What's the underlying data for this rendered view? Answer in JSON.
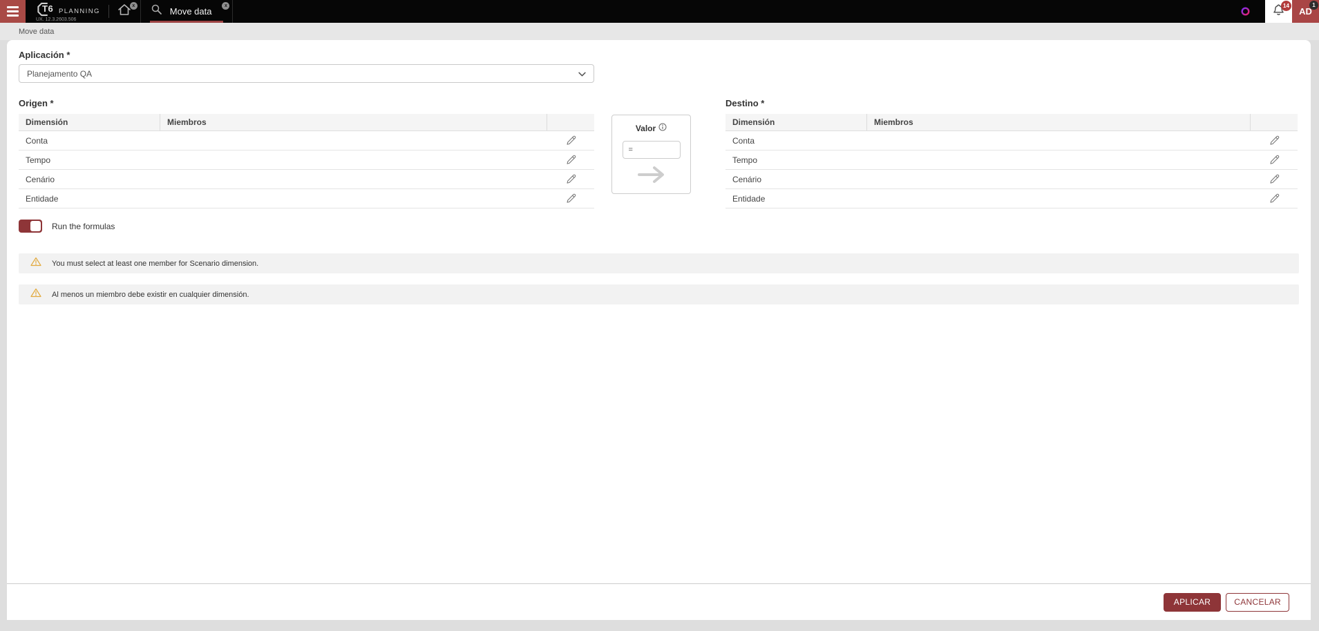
{
  "header": {
    "logo": {
      "brand": "T6",
      "product": "PLANNING",
      "version": "UX. 12.3.2603.506"
    },
    "tabs": [
      {
        "id": "home",
        "icon": "home-icon",
        "close_glyph": "x"
      },
      {
        "id": "move-data",
        "icon": "search-icon",
        "label": "Move data",
        "close_glyph": "x",
        "active": true
      }
    ],
    "notifications": {
      "icon": "bell-icon",
      "count": "14"
    },
    "avatar": {
      "initials": "AD",
      "badge": "1"
    }
  },
  "breadcrumb": "Move data",
  "form": {
    "application": {
      "label": "Aplicación *",
      "value": "Planejamento QA"
    },
    "origin": {
      "label": "Origen *",
      "columns": [
        "Dimensión",
        "Miembros"
      ],
      "rows": [
        {
          "dimension": "Conta",
          "members": ""
        },
        {
          "dimension": "Tempo",
          "members": ""
        },
        {
          "dimension": "Cenário",
          "members": ""
        },
        {
          "dimension": "Entidade",
          "members": ""
        }
      ]
    },
    "valor": {
      "label": "Valor",
      "operator": "="
    },
    "destination": {
      "label": "Destino *",
      "columns": [
        "Dimensión",
        "Miembros"
      ],
      "rows": [
        {
          "dimension": "Conta",
          "members": ""
        },
        {
          "dimension": "Tempo",
          "members": ""
        },
        {
          "dimension": "Cenário",
          "members": ""
        },
        {
          "dimension": "Entidade",
          "members": ""
        }
      ]
    },
    "run_formulas": {
      "label": "Run the formulas",
      "enabled": true
    },
    "warnings": [
      "You must select at least one member for Scenario dimension.",
      "Al menos un miembro debe existir en cualquier dimensión."
    ]
  },
  "footer": {
    "apply_label": "APLICAR",
    "cancel_label": "CANCELAR"
  },
  "colors": {
    "accent": "#8E3538",
    "header_bg": "#060606",
    "hamburger_bg": "#A94A46",
    "tab_underline": "#9D4343",
    "badge_red": "#B23B3B",
    "avatar_bg": "#A94545",
    "warning_yellow": "#E2A93C",
    "knot_gradient_start": "#7B2FF7",
    "knot_gradient_end": "#E91E63"
  }
}
